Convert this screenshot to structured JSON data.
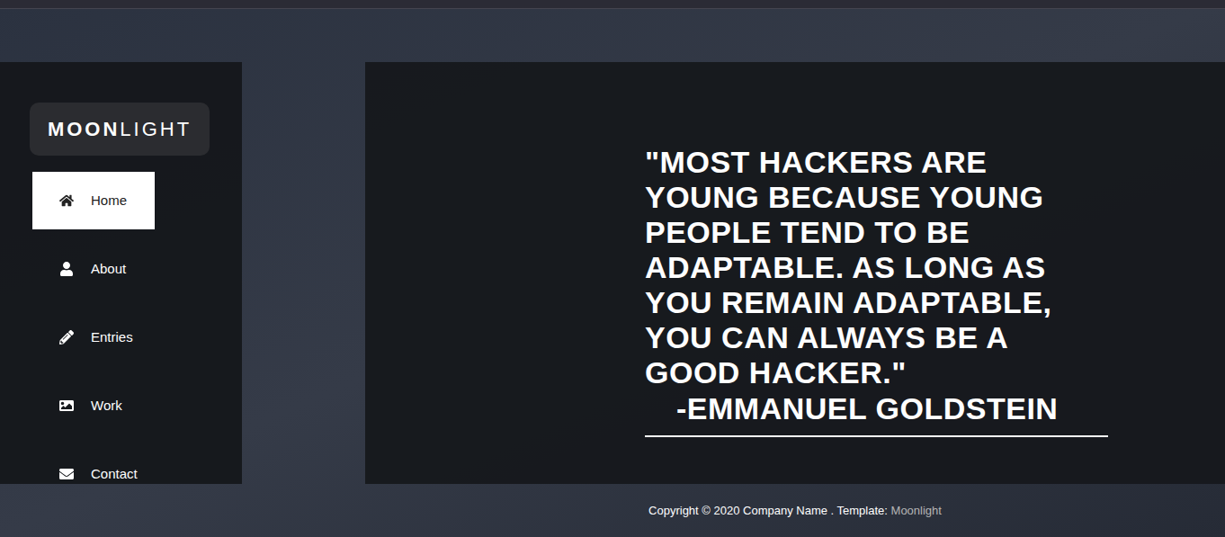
{
  "logo": {
    "bold": "MOON",
    "light": "LIGHT"
  },
  "sidebar": {
    "items": [
      {
        "label": "Home",
        "selected": true
      },
      {
        "label": "About",
        "selected": false
      },
      {
        "label": "Entries",
        "selected": false
      },
      {
        "label": "Work",
        "selected": false
      },
      {
        "label": "Contact",
        "selected": false
      }
    ]
  },
  "quote": {
    "text": "\"MOST HACKERS ARE YOUNG BECAUSE YOUNG PEOPLE TEND TO BE ADAPTABLE. AS LONG AS YOU REMAIN ADAPTABLE, YOU CAN ALWAYS BE A GOOD HACKER.\"",
    "author": "-EMMANUEL GOLDSTEIN"
  },
  "footer": {
    "text": "Copyright © 2020 Company Name . Template: ",
    "link": "Moonlight"
  }
}
